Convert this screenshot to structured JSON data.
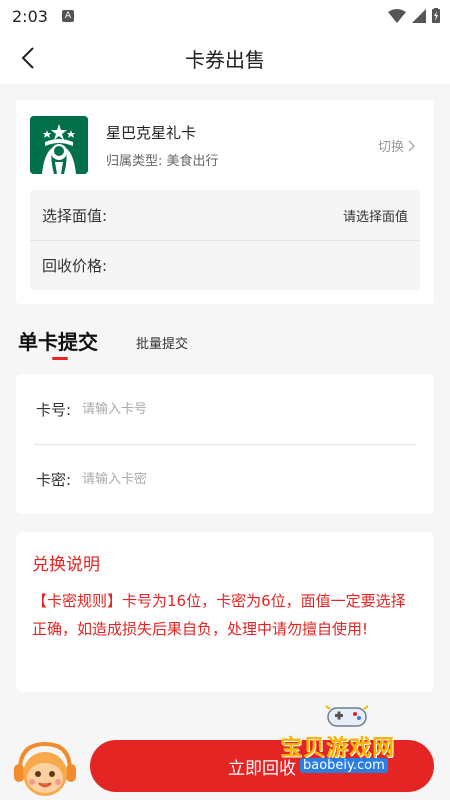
{
  "status_bar": {
    "time": "2:03",
    "notification_icon": "A"
  },
  "header": {
    "title": "卡券出售"
  },
  "card": {
    "name": "星巴克星礼卡",
    "type_label": "归属类型:",
    "type_value": "美食出行",
    "switch_label": "切换",
    "face_value_label": "选择面值:",
    "face_value_placeholder": "请选择面值",
    "recycle_price_label": "回收价格:"
  },
  "tabs": [
    {
      "label": "单卡提交",
      "active": true
    },
    {
      "label": "批量提交",
      "active": false
    }
  ],
  "form": {
    "card_number_label": "卡号:",
    "card_number_placeholder": "请输入卡号",
    "card_password_label": "卡密:",
    "card_password_placeholder": "请输入卡密"
  },
  "notice": {
    "title": "兑换说明",
    "text": "【卡密规则】卡号为16位，卡密为6位，面值一定要选择正确，如造成损失后果自负，处理中请勿擅自使用!"
  },
  "action": {
    "submit_label": "立即回收"
  },
  "watermark": {
    "text": "宝贝游戏网",
    "url": "baobeiy.com"
  },
  "colors": {
    "accent": "#e52424",
    "starbucks_green": "#00704a"
  }
}
